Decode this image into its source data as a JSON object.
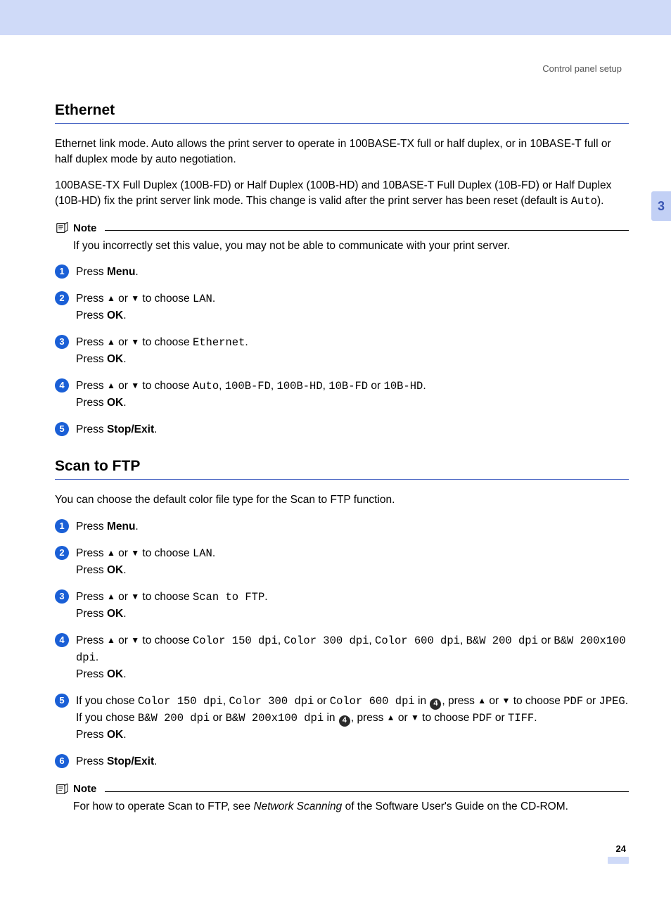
{
  "breadcrumb": "Control panel setup",
  "chapter_tab": "3",
  "page_number": "24",
  "ethernet": {
    "title": "Ethernet",
    "para1": "Ethernet link mode. Auto allows the print server to operate in 100BASE-TX full or half duplex, or in 10BASE-T full or half duplex mode by auto negotiation.",
    "para2_a": "100BASE-TX Full Duplex (100B-FD) or Half Duplex (100B-HD) and 10BASE-T Full Duplex (10B-FD) or Half Duplex (10B-HD) fix the print server link mode. This change is valid after the print server has been reset (default is ",
    "para2_mono": "Auto",
    "para2_b": ").",
    "note_label": "Note",
    "note_body": "If you incorrectly set this value, you may not be able to communicate with your print server.",
    "steps": {
      "s1": {
        "press": "Press ",
        "menu": "Menu",
        "dot": "."
      },
      "s2": {
        "a": "Press ",
        "up": "▲",
        "or": " or ",
        "down": "▼",
        "b": " to choose ",
        "opt": "LAN",
        "c": ".",
        "d": "Press ",
        "ok": "OK",
        "e": "."
      },
      "s3": {
        "a": "Press ",
        "up": "▲",
        "or": " or ",
        "down": "▼",
        "b": " to choose ",
        "opt": "Ethernet",
        "c": ".",
        "d": "Press ",
        "ok": "OK",
        "e": "."
      },
      "s4": {
        "a": "Press ",
        "up": "▲",
        "or": " or ",
        "down": "▼",
        "b": " to choose ",
        "o1": "Auto",
        "o2": "100B-FD",
        "o3": "100B-HD",
        "o4": "10B-FD",
        "o5": "10B-HD",
        "sep": ", ",
        "orw": " or ",
        "c": ".",
        "d": "Press ",
        "ok": "OK",
        "e": "."
      },
      "s5": {
        "press": "Press ",
        "btn": "Stop/Exit",
        "dot": "."
      }
    }
  },
  "scanftp": {
    "title": "Scan to FTP",
    "intro": "You can choose the default color file type for the Scan to FTP function.",
    "steps": {
      "s1": {
        "press": "Press ",
        "menu": "Menu",
        "dot": "."
      },
      "s2": {
        "a": "Press ",
        "up": "▲",
        "or": " or ",
        "down": "▼",
        "b": " to choose ",
        "opt": "LAN",
        "c": ".",
        "d": "Press ",
        "ok": "OK",
        "e": "."
      },
      "s3": {
        "a": "Press ",
        "up": "▲",
        "or": " or ",
        "down": "▼",
        "b": " to choose ",
        "opt": "Scan to FTP",
        "c": ".",
        "d": "Press ",
        "ok": "OK",
        "e": "."
      },
      "s4": {
        "a": "Press ",
        "up": "▲",
        "or": " or ",
        "down": "▼",
        "b": " to choose ",
        "o1": "Color 150 dpi",
        "o2": "Color 300 dpi",
        "o3": "Color 600 dpi",
        "o4": "B&W 200 dpi",
        "o5": "B&W 200x100 dpi",
        "sep": ", ",
        "orw": " or ",
        "c": ".",
        "d": "Press ",
        "ok": "OK",
        "e": "."
      },
      "s5": {
        "l1a": "If you chose ",
        "c1": "Color 150 dpi",
        "sep": ", ",
        "c2": "Color 300 dpi",
        "orw": " or ",
        "c3": "Color 600 dpi",
        "l1b": " in ",
        "ref": "4",
        "l1c": ", press ",
        "up": "▲",
        "or": " or ",
        "down": "▼",
        "l1d": " to choose ",
        "pdf": "PDF",
        "l1e": " or ",
        "jpeg": "JPEG",
        "l1f": ".",
        "l2a": "If you chose ",
        "b1": "B&W 200 dpi",
        "l2or": " or ",
        "b2": "B&W 200x100 dpi",
        "l2b": " in ",
        "l2c": ", press ",
        "l2d": " to choose ",
        "tiff": "TIFF",
        "l2e": ".",
        "d": "Press ",
        "ok": "OK",
        "e": "."
      },
      "s6": {
        "press": "Press ",
        "btn": "Stop/Exit",
        "dot": "."
      }
    },
    "note_label": "Note",
    "note_a": "For how to operate Scan to FTP, see ",
    "note_em": "Network Scanning",
    "note_b": " of the Software User's Guide on the CD-ROM."
  }
}
